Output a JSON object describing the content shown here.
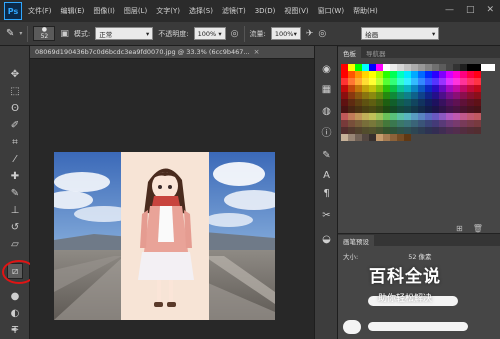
{
  "app": {
    "logo": "Ps"
  },
  "menu": [
    "文件(F)",
    "编辑(E)",
    "图像(I)",
    "图层(L)",
    "文字(Y)",
    "选择(S)",
    "滤镜(T)",
    "3D(D)",
    "视图(V)",
    "窗口(W)",
    "帮助(H)"
  ],
  "window_controls": [
    "—",
    "□",
    "✕"
  ],
  "options_bar": {
    "brush_size": "52",
    "mode_label": "模式:",
    "mode_value": "正常",
    "opacity_label": "不透明度:",
    "opacity_value": "100%",
    "flow_label": "流量:",
    "flow_value": "100%",
    "workspace_value": "绘画"
  },
  "document": {
    "tab_title": "08069d190436b7c0d6bcdc3ea9fd0070.jpg @ 33.3% (6cc9b467...",
    "close": "×"
  },
  "panels": {
    "swatch_tabs": [
      "色板",
      "导航器"
    ],
    "brush_tabs": [
      "画笔预设"
    ],
    "brush_size_label": "大小:",
    "brush_size_value": "52 像素"
  },
  "swatch_colors": {
    "accent": "#e01414",
    "panel_bg": "#464646"
  },
  "watermark": {
    "title": "百科全说",
    "subtitle": "助你轻松解决"
  },
  "icons": {
    "tools": [
      "move-icon",
      "marquee-icon",
      "lasso-icon",
      "quick-select-icon",
      "crop-icon",
      "eyedropper-icon",
      "healing-brush-icon",
      "brush-icon",
      "clone-stamp-icon",
      "history-brush-icon",
      "eraser-icon",
      "gradient-icon",
      "blur-icon",
      "dodge-icon",
      "pen-icon",
      "type-icon"
    ],
    "panel_column": [
      "color-icon",
      "swatches-icon",
      "adjustments-icon",
      "info-icon",
      "brush-settings-icon",
      "character-icon",
      "paragraph-icon",
      "tool-presets-icon",
      "3d-icon"
    ]
  }
}
